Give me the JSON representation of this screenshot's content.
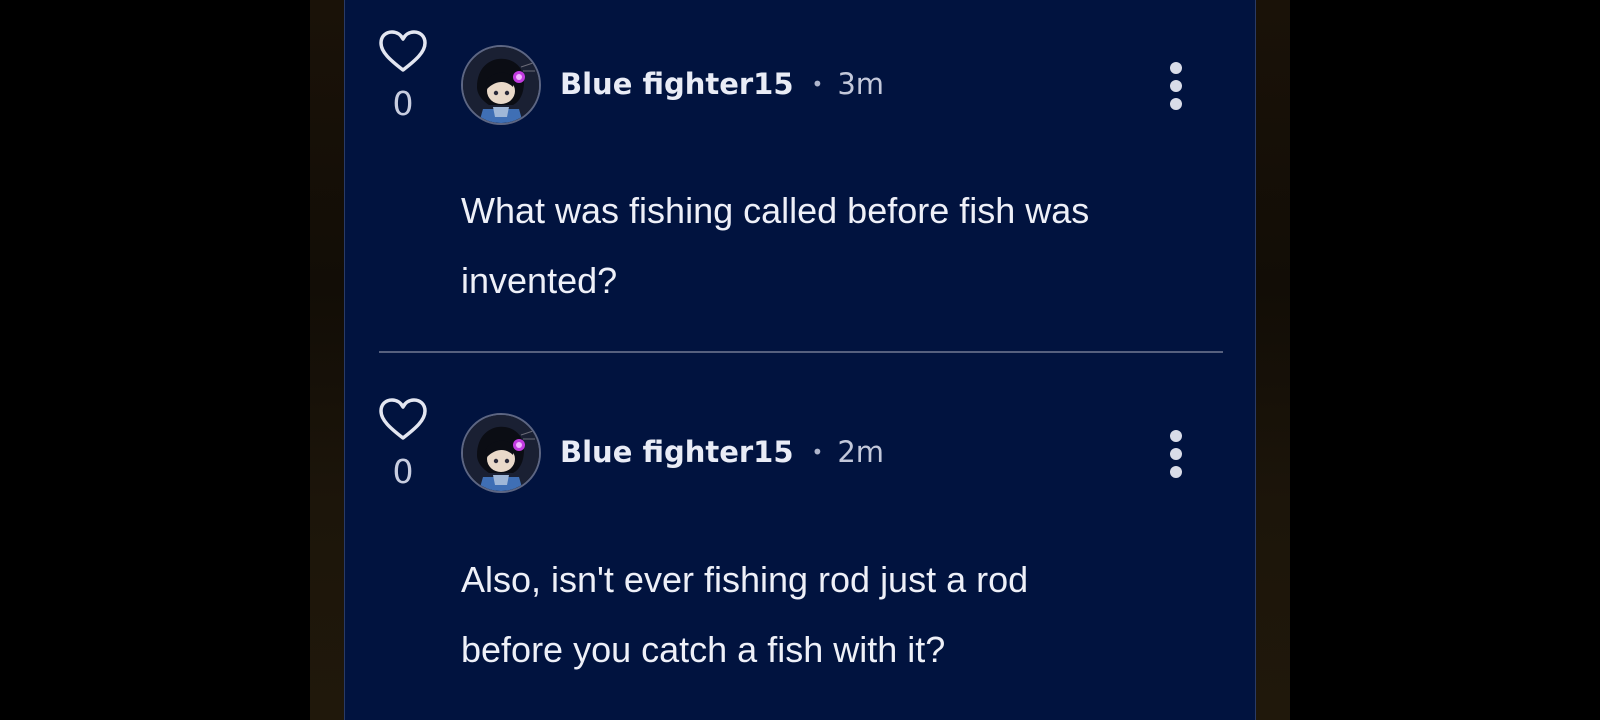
{
  "comments": [
    {
      "likes": "0",
      "username": "Blue fighter15",
      "separator": "•",
      "time": "3m",
      "lines": [
        "What was fishing called before fish was",
        "invented?"
      ]
    },
    {
      "likes": "0",
      "username": "Blue fighter15",
      "separator": "•",
      "time": "2m",
      "lines": [
        "Also, isn't ever fishing rod just a rod",
        "before you catch a fish with it?"
      ]
    }
  ],
  "icons": {
    "like": "heart-outline-icon",
    "more": "vertical-ellipsis-icon"
  },
  "colors": {
    "panel_bg": "#01133f",
    "text": "#eef0f8",
    "divider": "#56607e"
  }
}
